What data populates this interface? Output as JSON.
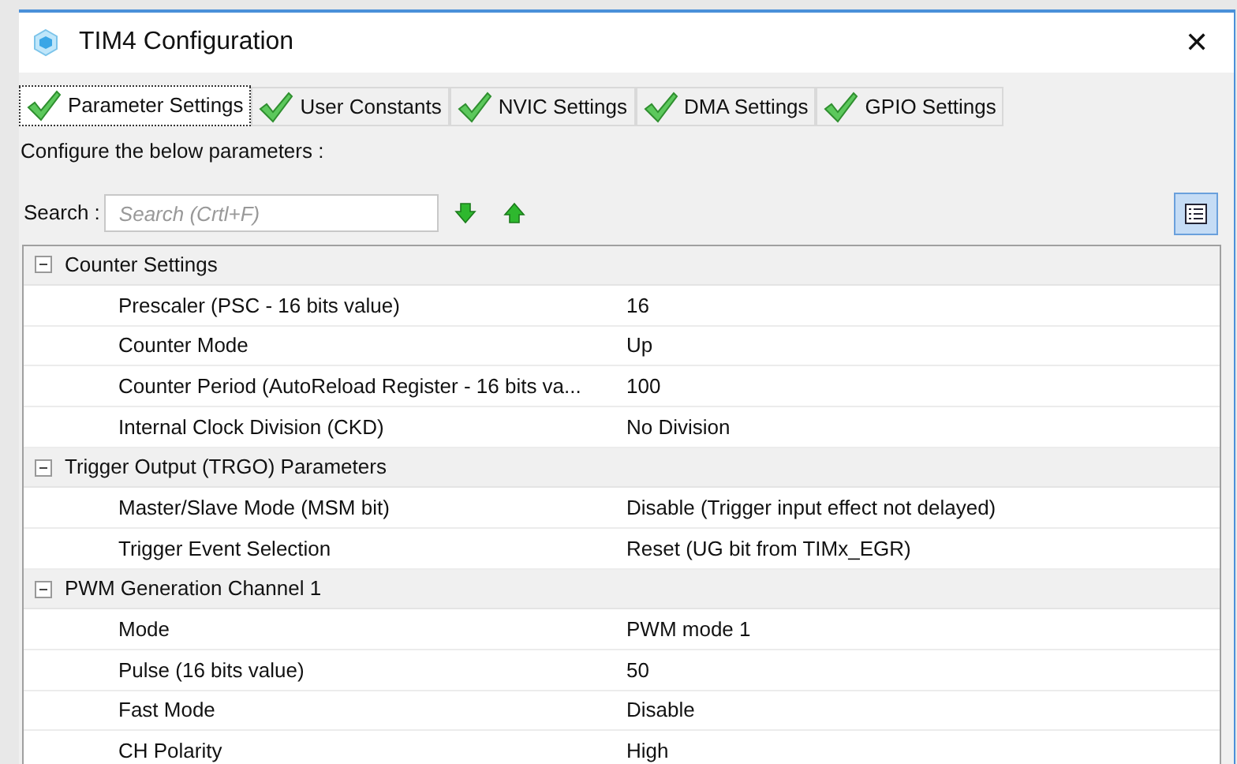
{
  "window": {
    "title": "TIM4 Configuration",
    "close": "✕"
  },
  "tabs": [
    {
      "label": "Parameter Settings",
      "selected": true
    },
    {
      "label": "User Constants",
      "selected": false
    },
    {
      "label": "NVIC Settings",
      "selected": false
    },
    {
      "label": "DMA Settings",
      "selected": false
    },
    {
      "label": "GPIO Settings",
      "selected": false
    }
  ],
  "instruction": "Configure the below parameters :",
  "search": {
    "label": "Search :",
    "placeholder": "Search (Crtl+F)"
  },
  "groups": [
    {
      "title": "Counter Settings",
      "expanded": true,
      "rows": [
        {
          "name": "Prescaler (PSC - 16 bits value)",
          "value": "16"
        },
        {
          "name": "Counter Mode",
          "value": "Up"
        },
        {
          "name": "Counter Period (AutoReload Register - 16 bits va...",
          "value": "100"
        },
        {
          "name": "Internal Clock Division (CKD)",
          "value": "No Division"
        }
      ]
    },
    {
      "title": "Trigger Output (TRGO) Parameters",
      "expanded": true,
      "rows": [
        {
          "name": "Master/Slave Mode (MSM bit)",
          "value": "Disable (Trigger input effect not delayed)"
        },
        {
          "name": "Trigger Event Selection",
          "value": "Reset (UG bit from TIMx_EGR)"
        }
      ]
    },
    {
      "title": "PWM Generation Channel 1",
      "expanded": true,
      "rows": [
        {
          "name": "Mode",
          "value": "PWM mode 1"
        },
        {
          "name": "Pulse (16 bits value)",
          "value": "50"
        },
        {
          "name": "Fast Mode",
          "value": "Disable"
        },
        {
          "name": "CH Polarity",
          "value": "High"
        }
      ]
    }
  ]
}
